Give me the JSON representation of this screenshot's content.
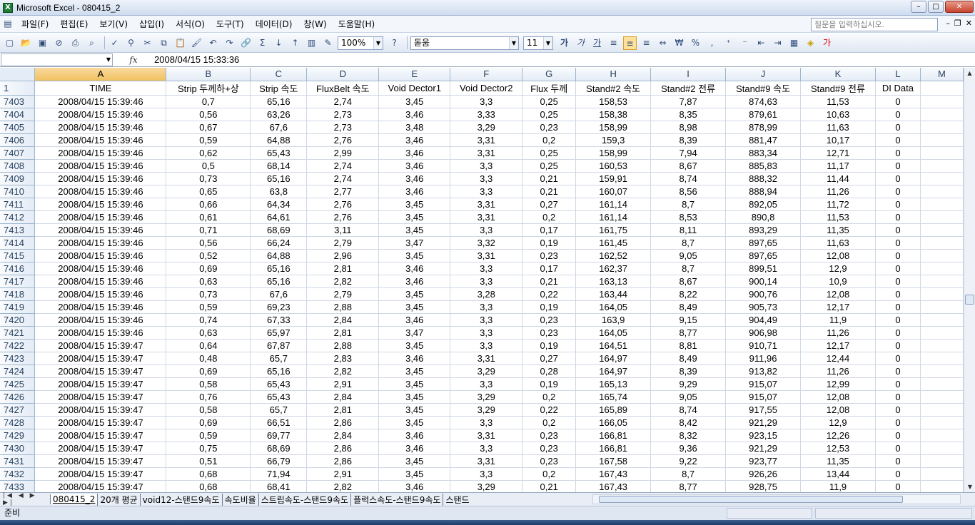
{
  "window": {
    "title": "Microsoft Excel - 080415_2",
    "app_icon_letter": "X"
  },
  "menu": [
    "파일(F)",
    "편집(E)",
    "보기(V)",
    "삽입(I)",
    "서식(O)",
    "도구(T)",
    "데이터(D)",
    "창(W)",
    "도움말(H)"
  ],
  "help_placeholder": "질문을 입력하십시오.",
  "toolbar": {
    "zoom": "100%",
    "font": "돋움",
    "font_size": "11"
  },
  "formula": {
    "name_box": "",
    "fx": "fx",
    "value": "2008/04/15  15:33:36"
  },
  "columns": [
    "A",
    "B",
    "C",
    "D",
    "E",
    "F",
    "G",
    "H",
    "I",
    "J",
    "K",
    "L",
    "M"
  ],
  "header_row": {
    "row": "1",
    "cells": [
      "TIME",
      "Strip 두께하+상",
      "Strip 속도",
      "FluxBelt 속도",
      "Void Dector1",
      "Void Dector2",
      "Flux 두께",
      "Stand#2 속도",
      "Stand#2 전류",
      "Stand#9 속도",
      "Stand#9 전류",
      "DI Data",
      ""
    ]
  },
  "rows": [
    [
      "7403",
      "2008/04/15  15:39:46",
      "0,7",
      "65,16",
      "2,74",
      "3,45",
      "3,3",
      "0,25",
      "158,53",
      "7,87",
      "874,63",
      "11,53",
      "0"
    ],
    [
      "7404",
      "2008/04/15  15:39:46",
      "0,56",
      "63,26",
      "2,73",
      "3,46",
      "3,33",
      "0,25",
      "158,38",
      "8,35",
      "879,61",
      "10,63",
      "0"
    ],
    [
      "7405",
      "2008/04/15  15:39:46",
      "0,67",
      "67,6",
      "2,73",
      "3,48",
      "3,29",
      "0,23",
      "158,99",
      "8,98",
      "878,99",
      "11,63",
      "0"
    ],
    [
      "7406",
      "2008/04/15  15:39:46",
      "0,59",
      "64,88",
      "2,76",
      "3,46",
      "3,31",
      "0,2",
      "159,3",
      "8,39",
      "881,47",
      "10,17",
      "0"
    ],
    [
      "7407",
      "2008/04/15  15:39:46",
      "0,62",
      "65,43",
      "2,99",
      "3,46",
      "3,31",
      "0,25",
      "158,99",
      "7,94",
      "883,34",
      "12,71",
      "0"
    ],
    [
      "7408",
      "2008/04/15  15:39:46",
      "0,5",
      "68,14",
      "2,74",
      "3,46",
      "3,3",
      "0,25",
      "160,53",
      "8,67",
      "885,83",
      "11,17",
      "0"
    ],
    [
      "7409",
      "2008/04/15  15:39:46",
      "0,73",
      "65,16",
      "2,74",
      "3,46",
      "3,3",
      "0,21",
      "159,91",
      "8,74",
      "888,32",
      "11,44",
      "0"
    ],
    [
      "7410",
      "2008/04/15  15:39:46",
      "0,65",
      "63,8",
      "2,77",
      "3,46",
      "3,3",
      "0,21",
      "160,07",
      "8,56",
      "888,94",
      "11,26",
      "0"
    ],
    [
      "7411",
      "2008/04/15  15:39:46",
      "0,66",
      "64,34",
      "2,76",
      "3,45",
      "3,31",
      "0,27",
      "161,14",
      "8,7",
      "892,05",
      "11,72",
      "0"
    ],
    [
      "7412",
      "2008/04/15  15:39:46",
      "0,61",
      "64,61",
      "2,76",
      "3,45",
      "3,31",
      "0,2",
      "161,14",
      "8,53",
      "890,8",
      "11,53",
      "0"
    ],
    [
      "7413",
      "2008/04/15  15:39:46",
      "0,71",
      "68,69",
      "3,11",
      "3,45",
      "3,3",
      "0,17",
      "161,75",
      "8,11",
      "893,29",
      "11,35",
      "0"
    ],
    [
      "7414",
      "2008/04/15  15:39:46",
      "0,56",
      "66,24",
      "2,79",
      "3,47",
      "3,32",
      "0,19",
      "161,45",
      "8,7",
      "897,65",
      "11,63",
      "0"
    ],
    [
      "7415",
      "2008/04/15  15:39:46",
      "0,52",
      "64,88",
      "2,96",
      "3,45",
      "3,31",
      "0,23",
      "162,52",
      "9,05",
      "897,65",
      "12,08",
      "0"
    ],
    [
      "7416",
      "2008/04/15  15:39:46",
      "0,69",
      "65,16",
      "2,81",
      "3,46",
      "3,3",
      "0,17",
      "162,37",
      "8,7",
      "899,51",
      "12,9",
      "0"
    ],
    [
      "7417",
      "2008/04/15  15:39:46",
      "0,63",
      "65,16",
      "2,82",
      "3,46",
      "3,3",
      "0,21",
      "163,13",
      "8,67",
      "900,14",
      "10,9",
      "0"
    ],
    [
      "7418",
      "2008/04/15  15:39:46",
      "0,73",
      "67,6",
      "2,79",
      "3,45",
      "3,28",
      "0,22",
      "163,44",
      "8,22",
      "900,76",
      "12,08",
      "0"
    ],
    [
      "7419",
      "2008/04/15  15:39:46",
      "0,59",
      "69,23",
      "2,88",
      "3,45",
      "3,3",
      "0,19",
      "164,05",
      "8,49",
      "905,73",
      "12,17",
      "0"
    ],
    [
      "7420",
      "2008/04/15  15:39:46",
      "0,74",
      "67,33",
      "2,84",
      "3,46",
      "3,3",
      "0,23",
      "163,9",
      "9,15",
      "904,49",
      "11,9",
      "0"
    ],
    [
      "7421",
      "2008/04/15  15:39:46",
      "0,63",
      "65,97",
      "2,81",
      "3,47",
      "3,3",
      "0,23",
      "164,05",
      "8,77",
      "906,98",
      "11,26",
      "0"
    ],
    [
      "7422",
      "2008/04/15  15:39:47",
      "0,64",
      "67,87",
      "2,88",
      "3,45",
      "3,3",
      "0,19",
      "164,51",
      "8,81",
      "910,71",
      "12,17",
      "0"
    ],
    [
      "7423",
      "2008/04/15  15:39:47",
      "0,48",
      "65,7",
      "2,83",
      "3,46",
      "3,31",
      "0,27",
      "164,97",
      "8,49",
      "911,96",
      "12,44",
      "0"
    ],
    [
      "7424",
      "2008/04/15  15:39:47",
      "0,69",
      "65,16",
      "2,82",
      "3,45",
      "3,29",
      "0,28",
      "164,97",
      "8,39",
      "913,82",
      "11,26",
      "0"
    ],
    [
      "7425",
      "2008/04/15  15:39:47",
      "0,58",
      "65,43",
      "2,91",
      "3,45",
      "3,3",
      "0,19",
      "165,13",
      "9,29",
      "915,07",
      "12,99",
      "0"
    ],
    [
      "7426",
      "2008/04/15  15:39:47",
      "0,76",
      "65,43",
      "2,84",
      "3,45",
      "3,29",
      "0,2",
      "165,74",
      "9,05",
      "915,07",
      "12,08",
      "0"
    ],
    [
      "7427",
      "2008/04/15  15:39:47",
      "0,58",
      "65,7",
      "2,81",
      "3,45",
      "3,29",
      "0,22",
      "165,89",
      "8,74",
      "917,55",
      "12,08",
      "0"
    ],
    [
      "7428",
      "2008/04/15  15:39:47",
      "0,69",
      "66,51",
      "2,86",
      "3,45",
      "3,3",
      "0,2",
      "166,05",
      "8,42",
      "921,29",
      "12,9",
      "0"
    ],
    [
      "7429",
      "2008/04/15  15:39:47",
      "0,59",
      "69,77",
      "2,84",
      "3,46",
      "3,31",
      "0,23",
      "166,81",
      "8,32",
      "923,15",
      "12,26",
      "0"
    ],
    [
      "7430",
      "2008/04/15  15:39:47",
      "0,75",
      "68,69",
      "2,86",
      "3,46",
      "3,3",
      "0,23",
      "166,81",
      "9,36",
      "921,29",
      "12,53",
      "0"
    ],
    [
      "7431",
      "2008/04/15  15:39:47",
      "0,51",
      "66,79",
      "2,86",
      "3,45",
      "3,31",
      "0,23",
      "167,58",
      "9,22",
      "923,77",
      "11,35",
      "0"
    ],
    [
      "7432",
      "2008/04/15  15:39:47",
      "0,68",
      "71,94",
      "2,91",
      "3,45",
      "3,3",
      "0,2",
      "167,43",
      "8,7",
      "926,26",
      "13,44",
      "0"
    ],
    [
      "7433",
      "2008/04/15  15:39:47",
      "0,68",
      "68,41",
      "2,82",
      "3,46",
      "3,29",
      "0,21",
      "167,43",
      "8,77",
      "928,75",
      "11,9",
      "0"
    ]
  ],
  "sheet_tabs": [
    "080415_2",
    "20개 평균",
    "void12-스탠드9속도",
    "속도비율",
    "스트립속도-스탠드9속도",
    "플럭스속도-스탠드9속도",
    "스탠드"
  ],
  "status": "준비"
}
